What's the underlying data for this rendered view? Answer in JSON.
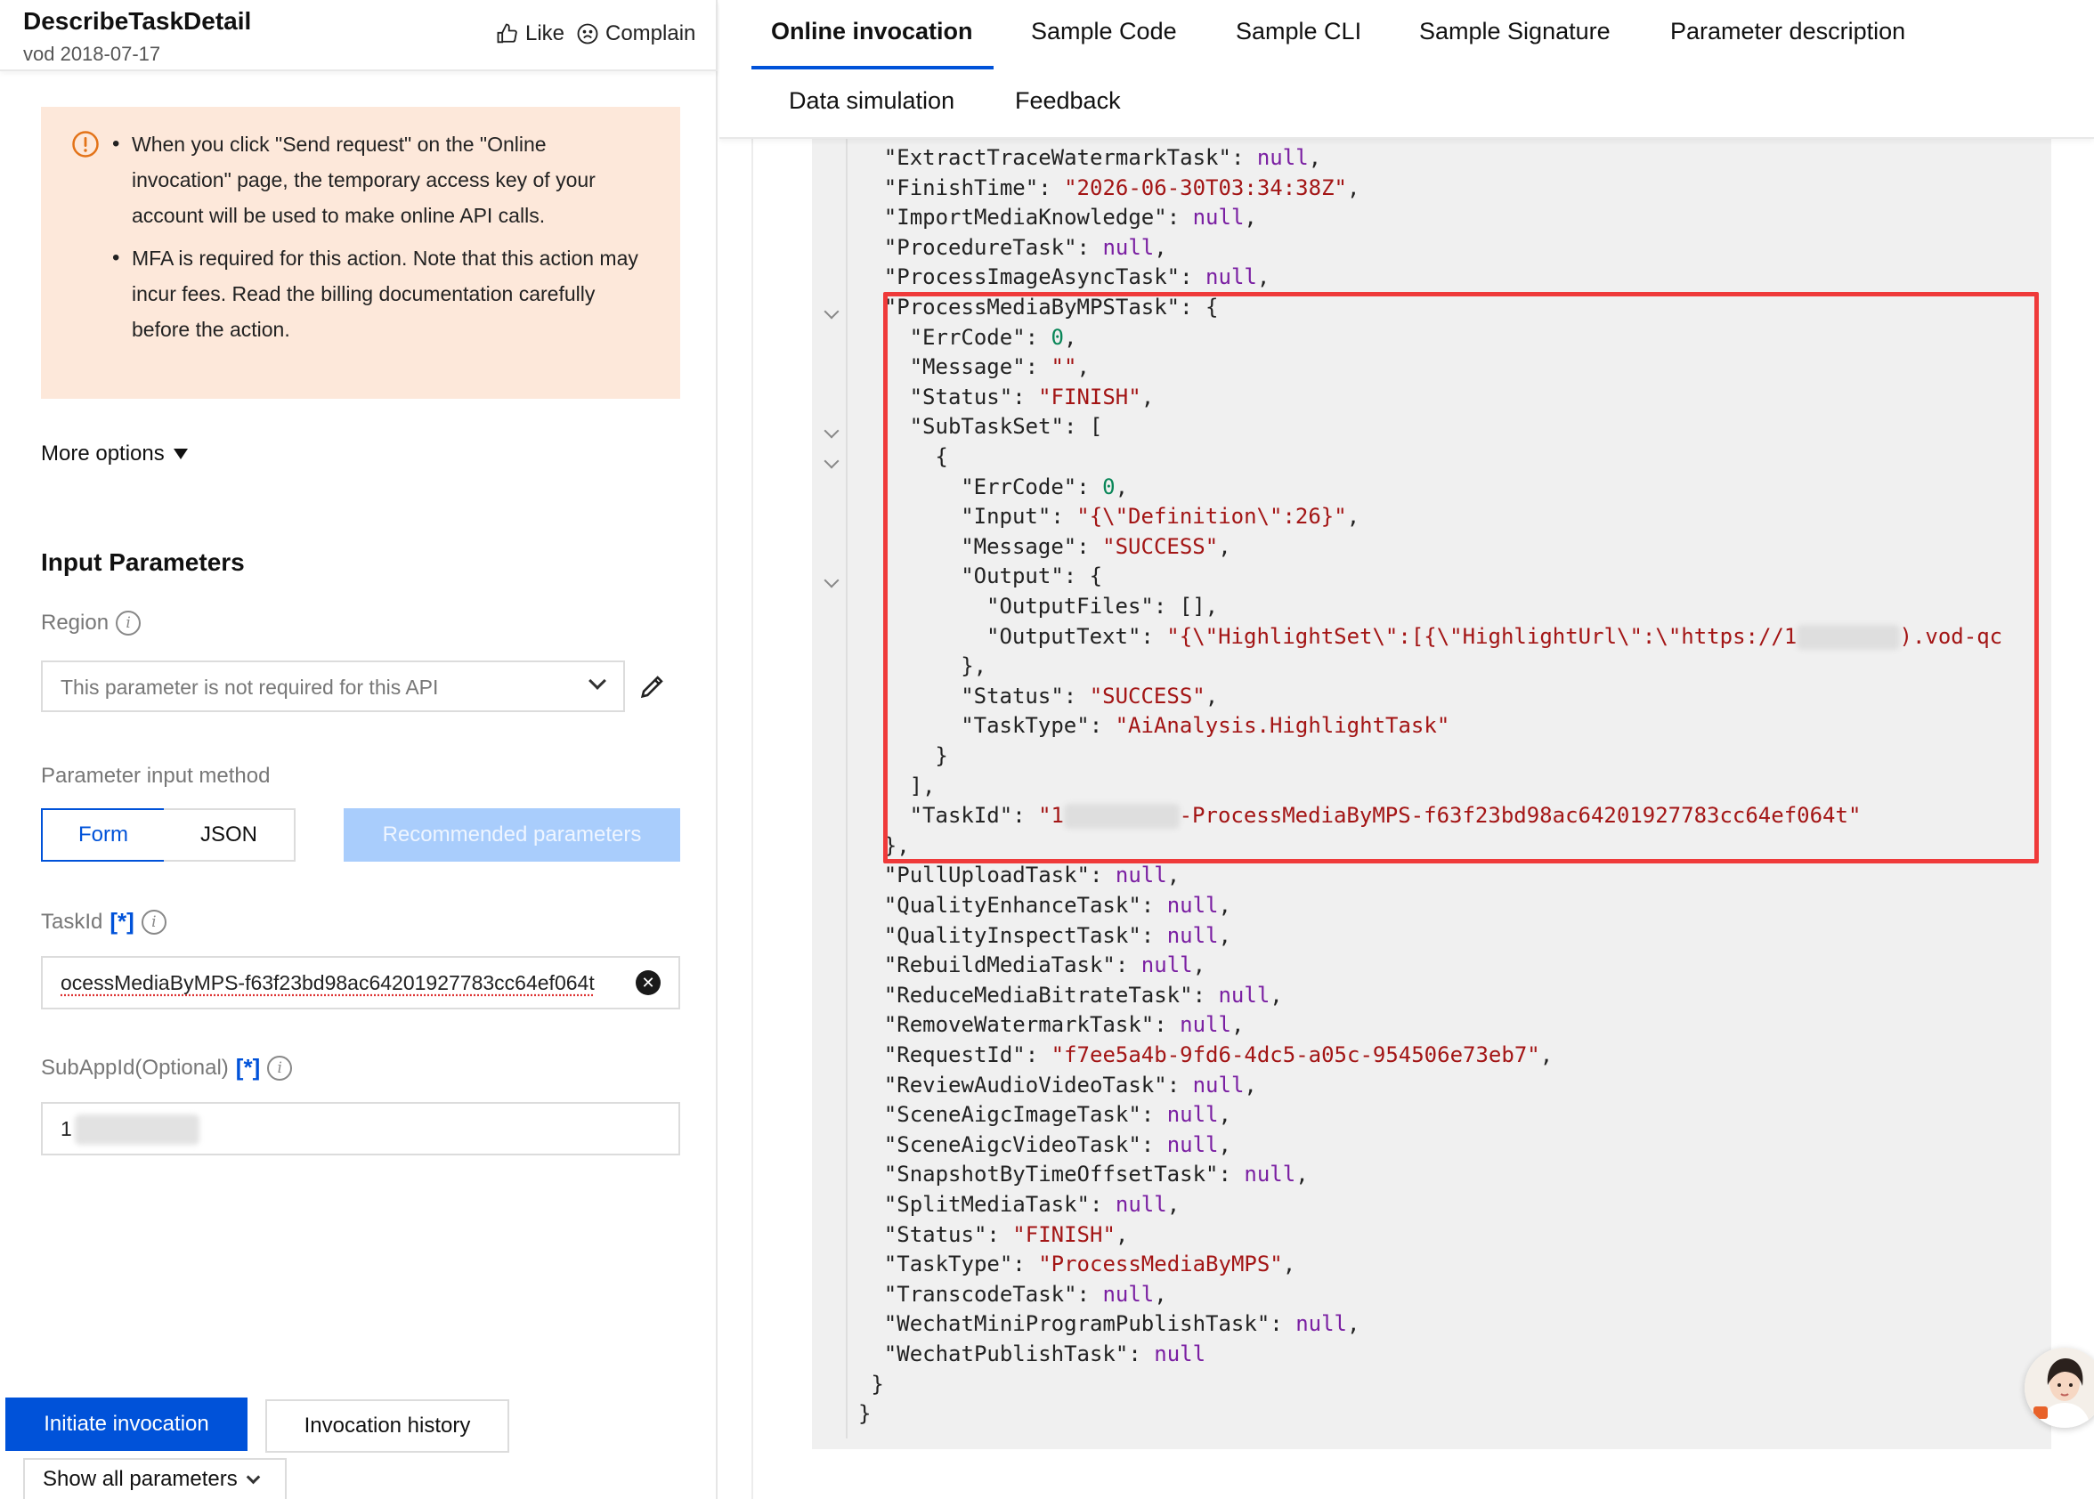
{
  "api": {
    "title": "DescribeTaskDetail",
    "subtitle": "vod 2018-07-17",
    "like_label": "Like",
    "complain_label": "Complain"
  },
  "notice": {
    "items": [
      "When you click \"Send request\" on the \"Online invocation\" page, the temporary access key of your account will be used to make online API calls.",
      "MFA is required for this action. Note that this action may incur fees. Read the billing documentation carefully before the action."
    ]
  },
  "more_options_label": "More options",
  "input_params": {
    "title": "Input Parameters",
    "region_label": "Region",
    "region_placeholder": "This parameter is not required for this API",
    "method_label": "Parameter input method",
    "method_form": "Form",
    "method_json": "JSON",
    "recommended_label": "Recommended parameters",
    "taskid_label": "TaskId",
    "taskid_required": "[*]",
    "taskid_value": "ocessMediaByMPS-f63f23bd98ac64201927783cc64ef064t",
    "subappid_label": "SubAppId(Optional)",
    "subappid_required": "[*]",
    "subappid_value": "1"
  },
  "footer": {
    "initiate_label": "Initiate invocation",
    "history_label": "Invocation history",
    "show_all_label": "Show all parameters"
  },
  "tabs": {
    "online": "Online invocation",
    "sample_code": "Sample Code",
    "sample_cli": "Sample CLI",
    "sample_signature": "Sample Signature",
    "param_desc": "Parameter description",
    "data_sim": "Data simulation",
    "feedback": "Feedback"
  },
  "code_lines": [
    {
      "indent": 2,
      "parts": [
        [
          "k",
          "\"ExtractTraceWatermarkTask\""
        ],
        [
          "p",
          ": "
        ],
        [
          "nl",
          "null"
        ],
        [
          "p",
          ","
        ]
      ]
    },
    {
      "indent": 2,
      "parts": [
        [
          "k",
          "\"FinishTime\""
        ],
        [
          "p",
          ": "
        ],
        [
          "s",
          "\"2026-06-30T03:34:38Z\""
        ],
        [
          "p",
          ","
        ]
      ]
    },
    {
      "indent": 2,
      "parts": [
        [
          "k",
          "\"ImportMediaKnowledge\""
        ],
        [
          "p",
          ": "
        ],
        [
          "nl",
          "null"
        ],
        [
          "p",
          ","
        ]
      ]
    },
    {
      "indent": 2,
      "parts": [
        [
          "k",
          "\"ProcedureTask\""
        ],
        [
          "p",
          ": "
        ],
        [
          "nl",
          "null"
        ],
        [
          "p",
          ","
        ]
      ]
    },
    {
      "indent": 2,
      "parts": [
        [
          "k",
          "\"ProcessImageAsyncTask\""
        ],
        [
          "p",
          ": "
        ],
        [
          "nl",
          "null"
        ],
        [
          "p",
          ","
        ]
      ]
    },
    {
      "indent": 2,
      "parts": [
        [
          "k",
          "\"ProcessMediaByMPSTask\""
        ],
        [
          "p",
          ": {"
        ]
      ]
    },
    {
      "indent": 4,
      "parts": [
        [
          "k",
          "\"ErrCode\""
        ],
        [
          "p",
          ": "
        ],
        [
          "n",
          "0"
        ],
        [
          "p",
          ","
        ]
      ]
    },
    {
      "indent": 4,
      "parts": [
        [
          "k",
          "\"Message\""
        ],
        [
          "p",
          ": "
        ],
        [
          "s",
          "\"\""
        ],
        [
          "p",
          ","
        ]
      ]
    },
    {
      "indent": 4,
      "parts": [
        [
          "k",
          "\"Status\""
        ],
        [
          "p",
          ": "
        ],
        [
          "s",
          "\"FINISH\""
        ],
        [
          "p",
          ","
        ]
      ]
    },
    {
      "indent": 4,
      "parts": [
        [
          "k",
          "\"SubTaskSet\""
        ],
        [
          "p",
          ": ["
        ]
      ]
    },
    {
      "indent": 6,
      "parts": [
        [
          "p",
          "{"
        ]
      ]
    },
    {
      "indent": 8,
      "parts": [
        [
          "k",
          "\"ErrCode\""
        ],
        [
          "p",
          ": "
        ],
        [
          "n",
          "0"
        ],
        [
          "p",
          ","
        ]
      ]
    },
    {
      "indent": 8,
      "parts": [
        [
          "k",
          "\"Input\""
        ],
        [
          "p",
          ": "
        ],
        [
          "s",
          "\"{\\\"Definition\\\":26}\""
        ],
        [
          "p",
          ","
        ]
      ]
    },
    {
      "indent": 8,
      "parts": [
        [
          "k",
          "\"Message\""
        ],
        [
          "p",
          ": "
        ],
        [
          "s",
          "\"SUCCESS\""
        ],
        [
          "p",
          ","
        ]
      ]
    },
    {
      "indent": 8,
      "parts": [
        [
          "k",
          "\"Output\""
        ],
        [
          "p",
          ": {"
        ]
      ]
    },
    {
      "indent": 10,
      "parts": [
        [
          "k",
          "\"OutputFiles\""
        ],
        [
          "p",
          ": [],"
        ]
      ]
    },
    {
      "indent": 10,
      "parts": [
        [
          "k",
          "\"OutputText\""
        ],
        [
          "p",
          ": "
        ],
        [
          "s",
          "\"{\\\"HighlightSet\\\":[{\\\"HighlightUrl\\\":\\\"https://1"
        ],
        [
          "blur",
          "        "
        ],
        [
          "s",
          ").vod-qc"
        ]
      ]
    },
    {
      "indent": 8,
      "parts": [
        [
          "p",
          "},"
        ]
      ]
    },
    {
      "indent": 8,
      "parts": [
        [
          "k",
          "\"Status\""
        ],
        [
          "p",
          ": "
        ],
        [
          "s",
          "\"SUCCESS\""
        ],
        [
          "p",
          ","
        ]
      ]
    },
    {
      "indent": 8,
      "parts": [
        [
          "k",
          "\"TaskType\""
        ],
        [
          "p",
          ": "
        ],
        [
          "s",
          "\"AiAnalysis.HighlightTask\""
        ]
      ]
    },
    {
      "indent": 6,
      "parts": [
        [
          "p",
          "}"
        ]
      ]
    },
    {
      "indent": 4,
      "parts": [
        [
          "p",
          "],"
        ]
      ]
    },
    {
      "indent": 4,
      "parts": [
        [
          "k",
          "\"TaskId\""
        ],
        [
          "p",
          ": "
        ],
        [
          "s",
          "\"1"
        ],
        [
          "blur",
          "         "
        ],
        [
          "s",
          "-ProcessMediaByMPS-f63f23bd98ac64201927783cc64ef064t\""
        ]
      ]
    },
    {
      "indent": 2,
      "parts": [
        [
          "p",
          "},"
        ]
      ]
    },
    {
      "indent": 2,
      "parts": [
        [
          "k",
          "\"PullUploadTask\""
        ],
        [
          "p",
          ": "
        ],
        [
          "nl",
          "null"
        ],
        [
          "p",
          ","
        ]
      ]
    },
    {
      "indent": 2,
      "parts": [
        [
          "k",
          "\"QualityEnhanceTask\""
        ],
        [
          "p",
          ": "
        ],
        [
          "nl",
          "null"
        ],
        [
          "p",
          ","
        ]
      ]
    },
    {
      "indent": 2,
      "parts": [
        [
          "k",
          "\"QualityInspectTask\""
        ],
        [
          "p",
          ": "
        ],
        [
          "nl",
          "null"
        ],
        [
          "p",
          ","
        ]
      ]
    },
    {
      "indent": 2,
      "parts": [
        [
          "k",
          "\"RebuildMediaTask\""
        ],
        [
          "p",
          ": "
        ],
        [
          "nl",
          "null"
        ],
        [
          "p",
          ","
        ]
      ]
    },
    {
      "indent": 2,
      "parts": [
        [
          "k",
          "\"ReduceMediaBitrateTask\""
        ],
        [
          "p",
          ": "
        ],
        [
          "nl",
          "null"
        ],
        [
          "p",
          ","
        ]
      ]
    },
    {
      "indent": 2,
      "parts": [
        [
          "k",
          "\"RemoveWatermarkTask\""
        ],
        [
          "p",
          ": "
        ],
        [
          "nl",
          "null"
        ],
        [
          "p",
          ","
        ]
      ]
    },
    {
      "indent": 2,
      "parts": [
        [
          "k",
          "\"RequestId\""
        ],
        [
          "p",
          ": "
        ],
        [
          "s",
          "\"f7ee5a4b-9fd6-4dc5-a05c-954506e73eb7\""
        ],
        [
          "p",
          ","
        ]
      ]
    },
    {
      "indent": 2,
      "parts": [
        [
          "k",
          "\"ReviewAudioVideoTask\""
        ],
        [
          "p",
          ": "
        ],
        [
          "nl",
          "null"
        ],
        [
          "p",
          ","
        ]
      ]
    },
    {
      "indent": 2,
      "parts": [
        [
          "k",
          "\"SceneAigcImageTask\""
        ],
        [
          "p",
          ": "
        ],
        [
          "nl",
          "null"
        ],
        [
          "p",
          ","
        ]
      ]
    },
    {
      "indent": 2,
      "parts": [
        [
          "k",
          "\"SceneAigcVideoTask\""
        ],
        [
          "p",
          ": "
        ],
        [
          "nl",
          "null"
        ],
        [
          "p",
          ","
        ]
      ]
    },
    {
      "indent": 2,
      "parts": [
        [
          "k",
          "\"SnapshotByTimeOffsetTask\""
        ],
        [
          "p",
          ": "
        ],
        [
          "nl",
          "null"
        ],
        [
          "p",
          ","
        ]
      ]
    },
    {
      "indent": 2,
      "parts": [
        [
          "k",
          "\"SplitMediaTask\""
        ],
        [
          "p",
          ": "
        ],
        [
          "nl",
          "null"
        ],
        [
          "p",
          ","
        ]
      ]
    },
    {
      "indent": 2,
      "parts": [
        [
          "k",
          "\"Status\""
        ],
        [
          "p",
          ": "
        ],
        [
          "s",
          "\"FINISH\""
        ],
        [
          "p",
          ","
        ]
      ]
    },
    {
      "indent": 2,
      "parts": [
        [
          "k",
          "\"TaskType\""
        ],
        [
          "p",
          ": "
        ],
        [
          "s",
          "\"ProcessMediaByMPS\""
        ],
        [
          "p",
          ","
        ]
      ]
    },
    {
      "indent": 2,
      "parts": [
        [
          "k",
          "\"TranscodeTask\""
        ],
        [
          "p",
          ": "
        ],
        [
          "nl",
          "null"
        ],
        [
          "p",
          ","
        ]
      ]
    },
    {
      "indent": 2,
      "parts": [
        [
          "k",
          "\"WechatMiniProgramPublishTask\""
        ],
        [
          "p",
          ": "
        ],
        [
          "nl",
          "null"
        ],
        [
          "p",
          ","
        ]
      ]
    },
    {
      "indent": 2,
      "parts": [
        [
          "k",
          "\"WechatPublishTask\""
        ],
        [
          "p",
          ": "
        ],
        [
          "nl",
          "null"
        ]
      ]
    },
    {
      "indent": 1,
      "parts": [
        [
          "p",
          "}"
        ]
      ]
    },
    {
      "indent": 0,
      "parts": [
        [
          "p",
          "}"
        ]
      ]
    }
  ],
  "colors": {
    "primary": "#0052d9",
    "highlight_border": "#ef3a3a",
    "notice_bg": "#fde8da",
    "string": "#a31515",
    "null": "#7a1fa2",
    "number": "#098658"
  }
}
